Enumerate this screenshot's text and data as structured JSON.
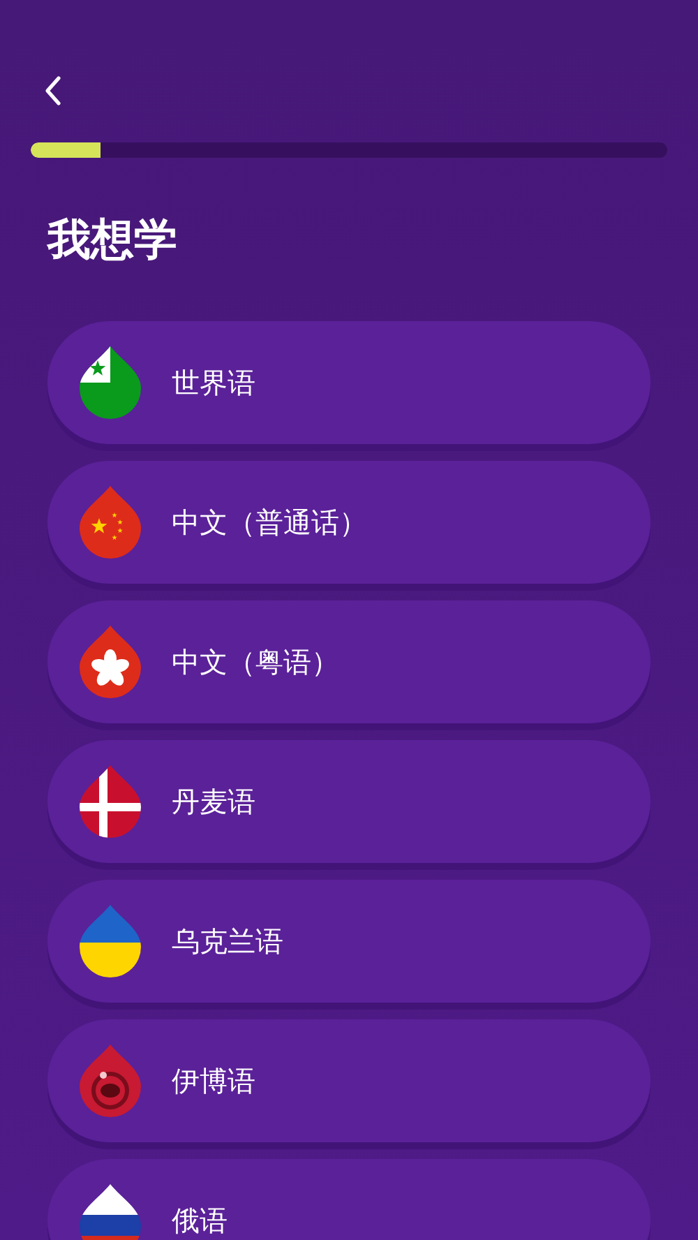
{
  "progress": {
    "level": 0.11
  },
  "title": "我想学",
  "languages": [
    {
      "name": "世界语",
      "kind": "esperanto"
    },
    {
      "name": "中文（普通话）",
      "kind": "china"
    },
    {
      "name": "中文（粤语）",
      "kind": "hongkong"
    },
    {
      "name": "丹麦语",
      "kind": "denmark"
    },
    {
      "name": "乌克兰语",
      "kind": "ukraine"
    },
    {
      "name": "伊博语",
      "kind": "igbo"
    },
    {
      "name": "俄语",
      "kind": "russia"
    }
  ]
}
